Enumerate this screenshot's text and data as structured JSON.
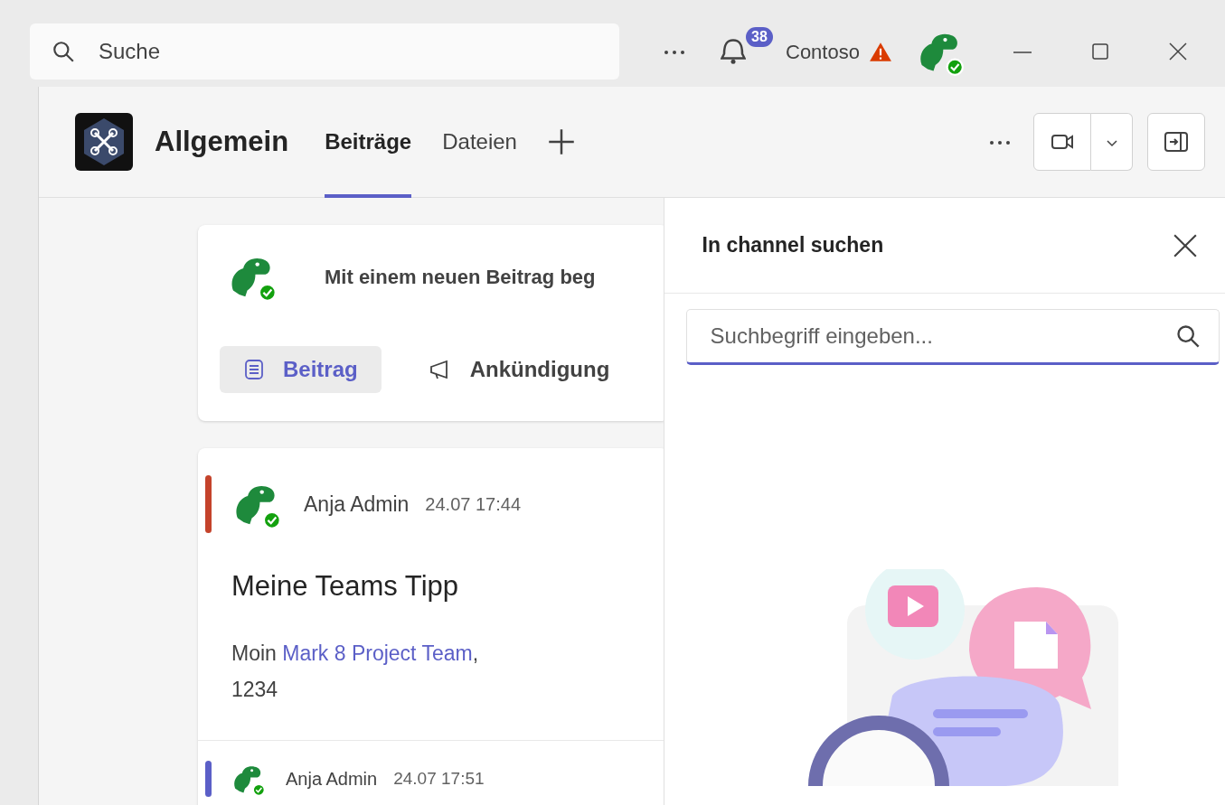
{
  "titlebar": {
    "search": {
      "placeholder": "Suche"
    },
    "notification_count": "38",
    "org": "Contoso",
    "user_available": true
  },
  "channel": {
    "name": "Allgemein",
    "tabs": [
      {
        "label": "Beiträge",
        "selected": true
      },
      {
        "label": "Dateien",
        "selected": false
      }
    ]
  },
  "compose": {
    "prompt": "Mit einem neuen Beitrag beg",
    "user_available": true,
    "buttons": [
      {
        "label": "Beitrag",
        "kind": "post",
        "selected": true
      },
      {
        "label": "Ankündigung",
        "kind": "announcement",
        "selected": false
      }
    ]
  },
  "posts": [
    {
      "author": "Anja Admin",
      "time": "24.07 17:44",
      "color": "#c4432b",
      "available": true,
      "title": "Meine Teams Tipp",
      "body": {
        "prefix": "Moin ",
        "mention": "Mark 8 Project Team",
        "suffix": ",",
        "line2": "1234"
      }
    },
    {
      "author": "Anja Admin",
      "time": "24.07 17:51",
      "color": "#5b5fc7",
      "available": true
    }
  ],
  "search_panel": {
    "title": "In channel suchen",
    "placeholder": "Suchbegriff eingeben..."
  }
}
